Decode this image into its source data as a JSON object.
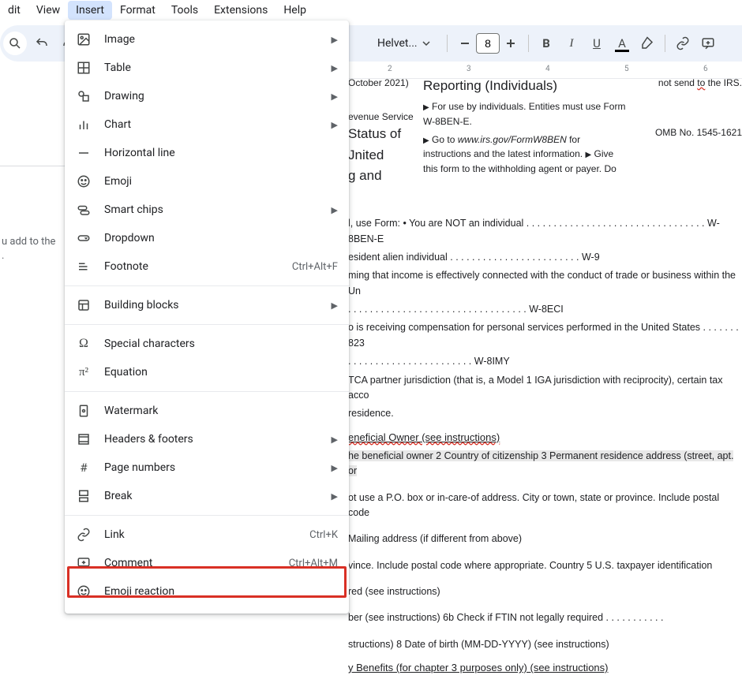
{
  "menubar": {
    "items": [
      "dit",
      "View",
      "Insert",
      "Format",
      "Tools",
      "Extensions",
      "Help"
    ],
    "active_index": 2
  },
  "toolbar": {
    "font_name": "Helvet...",
    "font_size": "8"
  },
  "ruler": {
    "ticks": [
      "2",
      "3",
      "4",
      "5",
      "6"
    ]
  },
  "sidebar_hint": {
    "line1": "u add to the",
    "line2": "."
  },
  "dropdown": {
    "items": [
      {
        "icon": "image-icon",
        "label": "Image",
        "arrow": true
      },
      {
        "icon": "table-icon",
        "label": "Table",
        "arrow": true
      },
      {
        "icon": "drawing-icon",
        "label": "Drawing",
        "arrow": true
      },
      {
        "icon": "chart-icon",
        "label": "Chart",
        "arrow": true
      },
      {
        "icon": "hr-icon",
        "label": "Horizontal line"
      },
      {
        "icon": "emoji-icon",
        "label": "Emoji"
      },
      {
        "icon": "chips-icon",
        "label": "Smart chips",
        "arrow": true
      },
      {
        "icon": "dropdown-icon",
        "label": "Dropdown"
      },
      {
        "icon": "footnote-icon",
        "label": "Footnote",
        "shortcut": "Ctrl+Alt+F"
      },
      {
        "sep": true
      },
      {
        "icon": "blocks-icon",
        "label": "Building blocks",
        "arrow": true
      },
      {
        "sep": true
      },
      {
        "icon": "omega-icon",
        "label": "Special characters"
      },
      {
        "icon": "pi-icon",
        "label": "Equation"
      },
      {
        "sep": true
      },
      {
        "icon": "watermark-icon",
        "label": "Watermark"
      },
      {
        "icon": "headers-icon",
        "label": "Headers & footers",
        "arrow": true
      },
      {
        "icon": "pagenum-icon",
        "label": "Page numbers",
        "arrow": true
      },
      {
        "icon": "break-icon",
        "label": "Break",
        "arrow": true
      },
      {
        "sep": true
      },
      {
        "icon": "link-icon",
        "label": "Link",
        "shortcut": "Ctrl+K"
      },
      {
        "icon": "comment-icon",
        "label": "Comment",
        "shortcut": "Ctrl+Alt+M"
      },
      {
        "icon": "emoji-reaction-icon",
        "label": "Emoji reaction"
      }
    ]
  },
  "doc": {
    "rev": "October 2021)",
    "dept": "evenue Service",
    "status1": "Status of",
    "status2": "Jnited",
    "status3": "g and",
    "reporting_title": "Reporting (Individuals)",
    "use_line": "For use by individuals. Entities must use Form W-8BEN-E.",
    "goto1": "Go to ",
    "goto_url": "www.irs.gov/FormW8BEN",
    "goto2": " for instructions and the latest information.",
    "give": "Give this form to the withholding agent or payer. Do",
    "not_send": "not send to the IRS.",
    "omb": "OMB No. 1545-1621",
    "useform": "l, use Form:  • You are NOT an individual . . . . . . . . . . . . . . . . . . . . . . . . . . . . . . . . . W-8BEN-E",
    "resident": "esident alien individual . . . . . . . . . . . . . . . . . . . . . . . . W-9",
    "claiming": "ming that income is effectively connected with the conduct of trade or business within the Un",
    "eci": ". . . . . . . . . . . . . . . . . . . . . . . . . . . . . . . . . W-8ECI",
    "comp": "o is receiving compensation for personal services performed in the United States . . . . . . . 823",
    "imy": ". . . . . . . . . . . . . . . . . . . . . . . W-8IMY",
    "tca": "TCA partner jurisdiction (that is, a Model 1 IGA jurisdiction with reciprocity), certain tax acco",
    "residence": "residence.",
    "sec_owner": "eneficial Owner (see instructions)",
    "owner_line": "he beneficial owner 2 Country of citizenship 3 Permanent residence address (street, apt. or",
    "pobox": "ot use a P.O. box or in-care-of address.  City or town, state or province. Include postal code",
    "mailing": "Mailing address (if different from above)",
    "province": "vince. Include postal code where appropriate. Country 5 U.S. taxpayer identification",
    "required": "red (see instructions)",
    "ftin": "ber (see instructions) 6b Check if FTIN not legally required . . . . . . . . . . .",
    "dob": "structions) 8 Date of birth (MM-DD-YYYY) (see instructions)",
    "sec_benefits": "y Benefits (for chapter 3 purposes only) (see instructions)"
  }
}
